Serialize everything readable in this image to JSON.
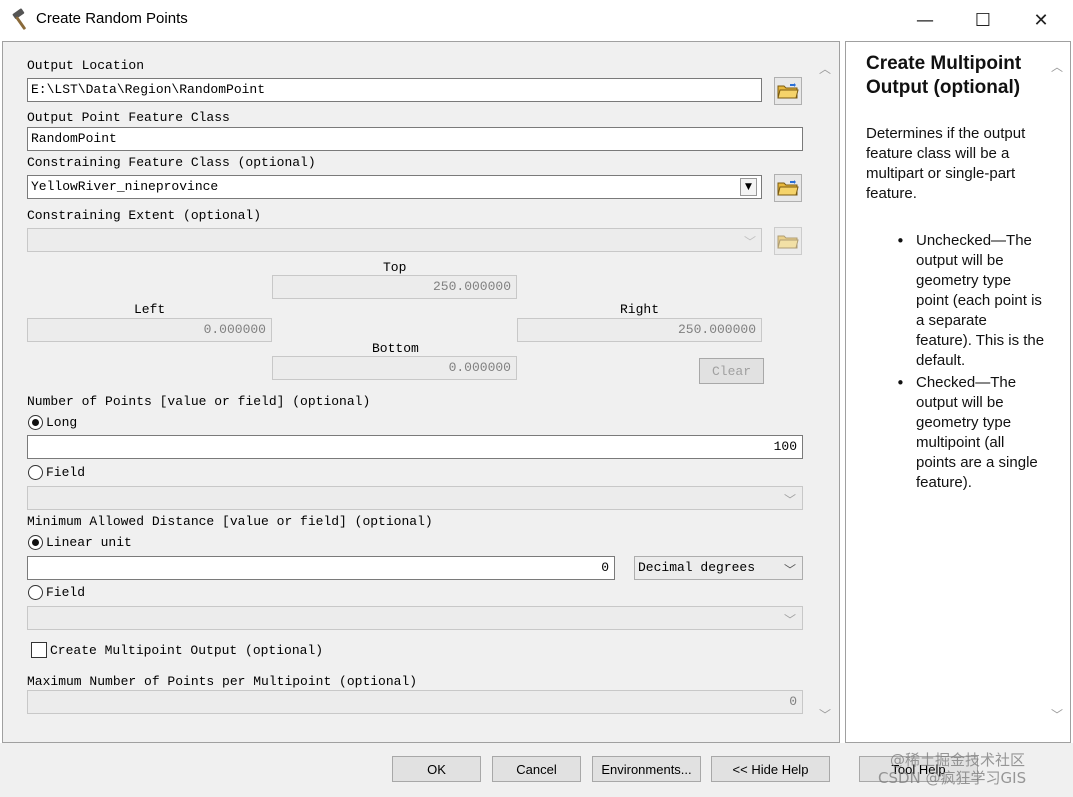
{
  "window": {
    "title": "Create Random Points",
    "icon": "hammer-icon",
    "minimize_glyph": "—",
    "maximize_glyph": "☐",
    "close_glyph": "✕"
  },
  "form": {
    "output_location": {
      "label": "Output Location",
      "value": "E:\\LST\\Data\\Region\\RandomPoint"
    },
    "output_feature_class": {
      "label": "Output Point Feature Class",
      "value": "RandomPoint"
    },
    "constraining_feature_class": {
      "label": "Constraining Feature Class (optional)",
      "value": "YellowRiver_nineprovince"
    },
    "constraining_extent": {
      "label": "Constraining Extent (optional)",
      "value": "",
      "top_label": "Top",
      "top_value": "250.000000",
      "left_label": "Left",
      "left_value": "0.000000",
      "right_label": "Right",
      "right_value": "250.000000",
      "bottom_label": "Bottom",
      "bottom_value": "0.000000",
      "clear_label": "Clear"
    },
    "number_of_points": {
      "label": "Number of Points [value or field] (optional)",
      "long_label": "Long",
      "long_value": "100",
      "field_label": "Field",
      "field_value": ""
    },
    "min_distance": {
      "label": "Minimum Allowed Distance [value or field] (optional)",
      "linear_label": "Linear unit",
      "linear_value": "0",
      "unit_value": "Decimal degrees",
      "field_label": "Field",
      "field_value": ""
    },
    "multipoint": {
      "label": "Create Multipoint Output (optional)",
      "checked": false
    },
    "max_points": {
      "label": "Maximum Number of Points per Multipoint (optional)",
      "value": "0"
    }
  },
  "help": {
    "title": "Create Multipoint Output (optional)",
    "description": "Determines if the output feature class will be a multipart or single-part feature.",
    "items": [
      "Unchecked—The output will be geometry type point (each point is a separate feature). This is the default.",
      "Checked—The output will be geometry type multipoint (all points are a single feature)."
    ]
  },
  "buttons": {
    "ok": "OK",
    "cancel": "Cancel",
    "environments": "Environments...",
    "hide_help": "<< Hide Help",
    "tool_help": "Tool Help"
  },
  "watermark": {
    "line1": "@稀土掘金技术社区",
    "line2": "CSDN @疯狂学习GIS"
  },
  "colors": {
    "panel_bg": "#f0f0f0",
    "field_disabled": "#ececec",
    "folder_yellow": "#e8b83c"
  }
}
